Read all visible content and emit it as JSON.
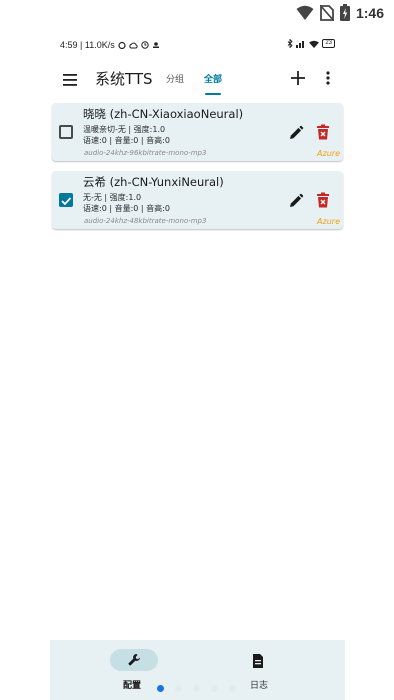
{
  "system_status": {
    "time": "1:46"
  },
  "inner_status": {
    "left": "4:59 | 11.0K/s",
    "right": "23"
  },
  "appbar": {
    "title": "系统TTS",
    "tabs": [
      {
        "label": "分组"
      },
      {
        "label": "全部"
      }
    ]
  },
  "voices": [
    {
      "name": "晓晓 (zh-CN-XiaoxiaoNeural)",
      "style_line": "温暖亲切-无 | 强度:1.0",
      "params_line": "语速:0 | 音量:0 | 音高:0",
      "format": "audio-24khz-96kbitrate-mono-mp3",
      "engine": "Azure",
      "checked": false
    },
    {
      "name": "云希 (zh-CN-YunxiNeural)",
      "style_line": "无-无 | 强度:1.0",
      "params_line": "语速:0 | 音量:0 | 音高:0",
      "format": "audio-24khz-48kbitrate-mono-mp3",
      "engine": "Azure",
      "checked": true
    }
  ],
  "bottom_nav": {
    "config_label": "配置",
    "log_label": "日志"
  },
  "colors": {
    "accent": "#00799a",
    "card_bg": "#e7f1f3",
    "engine": "#f39c12",
    "delete": "#c62828"
  }
}
